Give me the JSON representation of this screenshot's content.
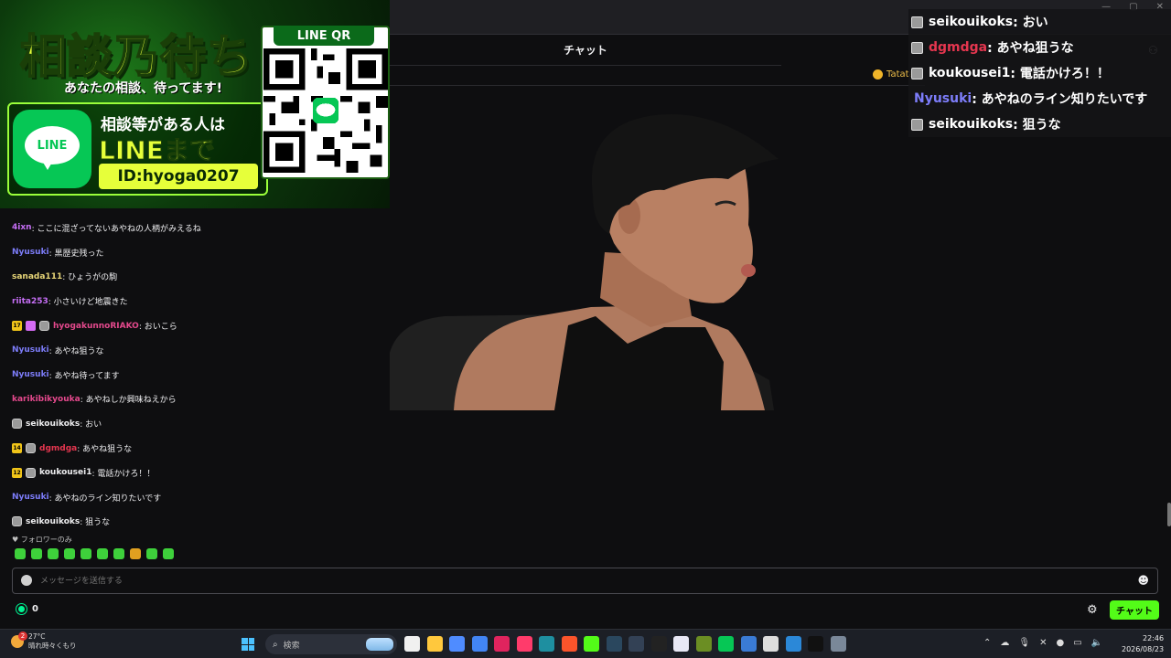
{
  "header": {
    "chat_tab": "チャット"
  },
  "pinned": {
    "label": "Tatata"
  },
  "promo": {
    "title": "相談乃待ち",
    "subtitle": "あなたの相談、待ってます!",
    "line_logo_text": "LINE",
    "line1": "相談等がある人は",
    "line2": "LINEまで",
    "id_text": "ID:hyoga0207",
    "qr_label": "LINE QR"
  },
  "chat": {
    "messages": [
      {
        "badges": [],
        "name": "4ixn",
        "color": "#c56ef5",
        "text": ": ここに混ざってないあやねの人柄がみえるね"
      },
      {
        "badges": [],
        "name": "Nyusuki",
        "color": "#7d7dfa",
        "text": ": 黒歴史残った"
      },
      {
        "badges": [],
        "name": "sanada111",
        "color": "#e8d678",
        "text": ": ひょうがの駒"
      },
      {
        "badges": [],
        "name": "riita253",
        "color": "#c56ef5",
        "text": ": 小さいけど地震きた"
      },
      {
        "badges": [
          "sub",
          "gift",
          "avatar"
        ],
        "sub_months": "17",
        "name": "hyogakunnoRIAKO",
        "color": "#e5498d",
        "text": ": おいこら"
      },
      {
        "badges": [],
        "name": "Nyusuki",
        "color": "#7d7dfa",
        "text": ": あやね狙うな"
      },
      {
        "badges": [],
        "name": "Nyusuki",
        "color": "#7d7dfa",
        "text": ": あやね待ってます"
      },
      {
        "badges": [],
        "name": "karikibikyouka",
        "color": "#e5498d",
        "text": ": あやねしか興味ねえから"
      },
      {
        "badges": [
          "avatar"
        ],
        "name": "seikouikoks",
        "color": "#efeff1",
        "text": ": おい"
      },
      {
        "badges": [
          "sub",
          "avatar"
        ],
        "sub_months": "14",
        "name": "dgmdga",
        "color": "#e5364f",
        "text": ": あやね狙うな"
      },
      {
        "badges": [
          "sub",
          "avatar"
        ],
        "sub_months": "12",
        "name": "koukousei1",
        "color": "#efeff1",
        "text": ": 電話かけろ！！"
      },
      {
        "badges": [],
        "name": "Nyusuki",
        "color": "#7d7dfa",
        "text": ": あやねのライン知りたいです"
      },
      {
        "badges": [
          "avatar"
        ],
        "name": "seikouikoks",
        "color": "#efeff1",
        "text": ": 狙うな"
      }
    ],
    "follower_note": "♥ フォロワーのみ",
    "input_placeholder": "メッセージを送信する",
    "points": "0",
    "send_label": "チャット"
  },
  "overlay": {
    "messages": [
      {
        "name": "seikouikoks",
        "color": "#ffffff",
        "avatar": true,
        "text": " : おい"
      },
      {
        "name": "dgmdga",
        "color": "#e5364f",
        "avatar": true,
        "text": " : あやね狙うな"
      },
      {
        "name": "koukousei1",
        "color": "#ffffff",
        "avatar": true,
        "text": " : 電話かけろ！！"
      },
      {
        "name": "Nyusuki",
        "color": "#7d7dfa",
        "avatar": false,
        "text": " : あやねのライン知りたいです"
      },
      {
        "name": "seikouikoks",
        "color": "#ffffff",
        "avatar": true,
        "text": " : 狙うな"
      }
    ]
  },
  "taskbar": {
    "weather_temp": "27°C",
    "weather_desc": "晴れ時々くもり",
    "weather_badge": "2",
    "search_label": "検索",
    "time": "22:46",
    "date": "2026/08/23",
    "apps": [
      "#f0f0f0",
      "#ffc83d",
      "#4f8cff",
      "#4285f4",
      "#e0245e",
      "#ff3b6b",
      "#1e8fa0",
      "#fb542b",
      "#53fc18",
      "#2a475e",
      "#334155",
      "#222222",
      "#e8e8f5",
      "#6b8e23",
      "#06c755",
      "#3a7bd5",
      "#dddddd",
      "#2b88d8",
      "#111111",
      "#7a8899"
    ]
  }
}
